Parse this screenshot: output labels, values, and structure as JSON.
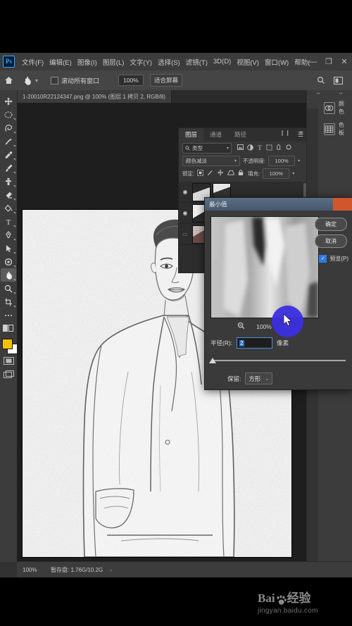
{
  "app": {
    "logo": "Ps",
    "menus": [
      "文件(F)",
      "编辑(E)",
      "图像(I)",
      "图层(L)",
      "文字(Y)",
      "选择(S)",
      "滤镜(T)",
      "3D(D)",
      "视图(V)",
      "窗口(W)",
      "帮助("
    ],
    "window_controls": {
      "minimize": "—",
      "maximize": "❐",
      "close": "✕"
    }
  },
  "options_bar": {
    "home_icon": "home-icon",
    "tool_icon": "hand-tool-icon",
    "dropdown_caret": "▾",
    "scroll_all_windows_label": "滚动所有窗口",
    "zoom_value": "100%",
    "fit_screen_label": "适合屏幕",
    "search_icon": "search-icon",
    "arrange_icon": "arrange-documents-icon"
  },
  "document_tab": {
    "title": "1-20010R22124347.png @ 100% (图层 1 拷贝 2, RGB/8)"
  },
  "toolbar": {
    "tools": [
      {
        "name": "move-tool",
        "glyph": "✥",
        "active": false
      },
      {
        "name": "marquee-tool",
        "glyph": "○",
        "active": false
      },
      {
        "name": "lasso-tool",
        "glyph": "✒",
        "active": false
      },
      {
        "name": "magic-wand-tool",
        "glyph": "✨",
        "active": false
      },
      {
        "name": "eyedropper-tool",
        "glyph": "⚲",
        "active": false
      },
      {
        "name": "brush-tool",
        "glyph": "🖌",
        "active": false
      },
      {
        "name": "clone-stamp-tool",
        "glyph": "⚱",
        "active": false
      },
      {
        "name": "eraser-tool",
        "glyph": "◣",
        "active": false
      },
      {
        "name": "paint-bucket-tool",
        "glyph": "◔",
        "active": false
      },
      {
        "name": "type-tool",
        "glyph": "T",
        "active": false
      },
      {
        "name": "pen-tool",
        "glyph": "✎",
        "active": false
      },
      {
        "name": "path-selection-tool",
        "glyph": "➤",
        "active": false
      },
      {
        "name": "shape-tool",
        "glyph": "⬤",
        "active": false
      },
      {
        "name": "hand-tool",
        "glyph": "✋",
        "active": true
      },
      {
        "name": "zoom-tool",
        "glyph": "🔍",
        "active": false
      },
      {
        "name": "crop-tool",
        "glyph": "⌗",
        "active": false
      },
      {
        "name": "edit-toolbar-tool",
        "glyph": "⋯",
        "active": false
      },
      {
        "name": "quick-mask-tool",
        "glyph": "◫",
        "active": false
      }
    ],
    "foreground_color": "#f2c200",
    "background_color": "#ffffff",
    "screen_mode_icons": [
      "quick-mask-icon",
      "screen-mode-icon"
    ]
  },
  "layers_panel": {
    "tabs": [
      {
        "label": "图层",
        "active": true
      },
      {
        "label": "通道",
        "active": false
      },
      {
        "label": "路径",
        "active": false
      }
    ],
    "filter_placeholder": "类型",
    "filter_icons": [
      "image-filter-icon",
      "adjustment-filter-icon",
      "type-filter-icon",
      "shape-filter-icon",
      "smart-object-filter-icon"
    ],
    "blend_mode": "颜色减淡",
    "opacity_label": "不透明度:",
    "opacity_value": "100%",
    "lock_label": "锁定:",
    "fill_label": "填充:",
    "fill_value": "100%",
    "lock_icons": [
      "lock-transparent-icon",
      "lock-image-icon",
      "lock-position-icon",
      "lock-artboard-icon",
      "lock-all-icon"
    ],
    "layers": [
      {
        "visible": true,
        "name": ""
      },
      {
        "visible": true,
        "name": ""
      },
      {
        "visible": false,
        "name": ""
      }
    ]
  },
  "right_dock": {
    "top_icons": [
      "search-icon",
      "arrange-icon"
    ],
    "buttons": [
      {
        "icon": "color-wheel-icon",
        "label": "颜色"
      },
      {
        "icon": "swatches-grid-icon",
        "label": "色板"
      }
    ]
  },
  "dialog": {
    "title": "最小值",
    "close_icon": "close-icon",
    "ok_label": "确定",
    "cancel_label": "取消",
    "preview_label": "预览(P)",
    "preview_checked": true,
    "zoom_out_icon": "zoom-out-icon",
    "zoom_in_icon": "zoom-in-icon",
    "zoom_value": "100%",
    "radius_label": "半径(R):",
    "radius_value": "2",
    "radius_unit": "像素",
    "keep_label": "保留:",
    "keep_value": "方形",
    "keep_caret": "⌄"
  },
  "status_bar": {
    "zoom": "100%",
    "scratch": "暂存盘: 1.76G/10.2G",
    "arrow": "›"
  },
  "watermark": {
    "brand_prefix": "Bai",
    "brand_mid": "du",
    "brand_suffix": "经验",
    "url": "jingyan.baidu.com"
  },
  "colors": {
    "accent_blue": "#2f7de1",
    "touch_indicator": "#3b2ee0",
    "dialog_close": "#d0562d",
    "foreground_swatch": "#f2c200"
  }
}
